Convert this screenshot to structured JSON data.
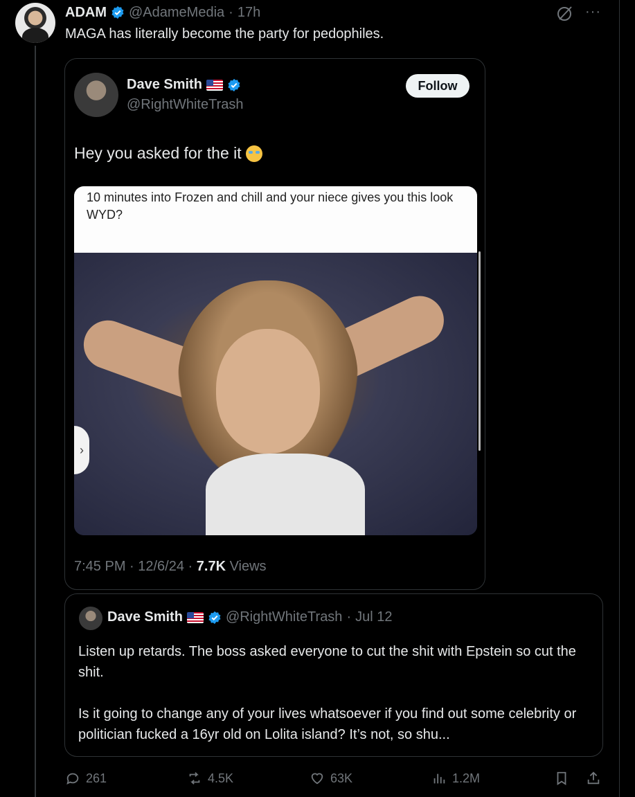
{
  "post": {
    "author_name": "ADAM",
    "handle": "@AdameMedia",
    "separator": "·",
    "time": "17h",
    "more": "···",
    "text": "MAGA has literally become the party for pedophiles."
  },
  "embedded_screenshot": {
    "name": "Dave Smith",
    "handle": "@RightWhiteTrash",
    "follow_label": "Follow",
    "text": "Hey you asked for the it",
    "meme_caption": "10 minutes into Frozen and chill and your niece gives you this look WYD?",
    "carousel_arrow": "›",
    "meta_time": "7:45 PM · 12/6/24 · ",
    "meta_views_count": "7.7K",
    "meta_views_label": " Views"
  },
  "quote": {
    "name": "Dave Smith",
    "handle": "@RightWhiteTrash",
    "separator": "·",
    "date": "Jul 12",
    "text": "Listen up retards. The boss asked everyone to cut the shit with Epstein so cut the shit.\n\nIs it going to change any of your lives whatsoever if you find out some celebrity or politician fucked a 16yr old on Lolita island? It’s not, so shu..."
  },
  "actions": {
    "replies": "261",
    "reposts": "4.5K",
    "likes": "63K",
    "views": "1.2M"
  },
  "colors": {
    "background": "#000000",
    "text": "#e7e9ea",
    "muted": "#71767b",
    "verified": "#1d9bf0",
    "border": "#2f3336"
  }
}
